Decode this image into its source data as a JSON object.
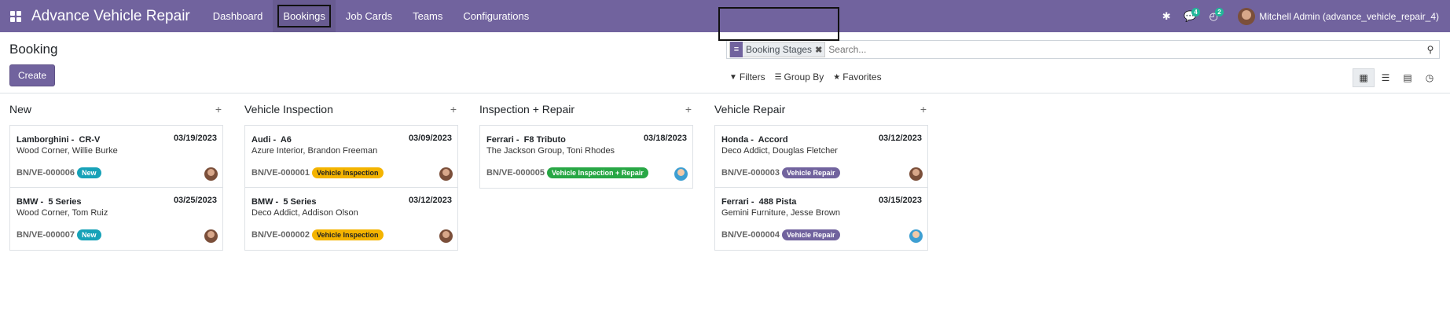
{
  "navbar": {
    "app_title": "Advance Vehicle Repair",
    "menu": [
      "Dashboard",
      "Bookings",
      "Job Cards",
      "Teams",
      "Configurations"
    ],
    "active_menu": "Bookings",
    "messages_count": "4",
    "activities_count": "2",
    "user_name": "Mitchell Admin (advance_vehicle_repair_4)"
  },
  "control": {
    "breadcrumb": "Booking",
    "create_label": "Create",
    "facet_label": "Booking Stages",
    "search_placeholder": "Search...",
    "filters_label": "Filters",
    "groupby_label": "Group By",
    "favorites_label": "Favorites"
  },
  "columns": [
    {
      "title": "New",
      "cards": [
        {
          "vehicle": "Lamborghini -  CR-V",
          "date": "03/19/2023",
          "customer": "Wood Corner, Willie Burke",
          "ref": "BN/VE-000006",
          "tag": "New"
        },
        {
          "vehicle": "BMW -  5 Series",
          "date": "03/25/2023",
          "customer": "Wood Corner, Tom Ruiz",
          "ref": "BN/VE-000007",
          "tag": "New"
        }
      ]
    },
    {
      "title": "Vehicle Inspection",
      "cards": [
        {
          "vehicle": "Audi -  A6",
          "date": "03/09/2023",
          "customer": "Azure Interior, Brandon Freeman",
          "ref": "BN/VE-000001",
          "tag": "Vehicle Inspection"
        },
        {
          "vehicle": "BMW -  5 Series",
          "date": "03/12/2023",
          "customer": "Deco Addict, Addison Olson",
          "ref": "BN/VE-000002",
          "tag": "Vehicle Inspection"
        }
      ]
    },
    {
      "title": "Inspection + Repair",
      "cards": [
        {
          "vehicle": "Ferrari -  F8 Tributo",
          "date": "03/18/2023",
          "customer": "The Jackson Group, Toni Rhodes",
          "ref": "BN/VE-000005",
          "tag": "Vehicle Inspection + Repair"
        }
      ]
    },
    {
      "title": "Vehicle Repair",
      "cards": [
        {
          "vehicle": "Honda -  Accord",
          "date": "03/12/2023",
          "customer": "Deco Addict, Douglas Fletcher",
          "ref": "BN/VE-000003",
          "tag": "Vehicle Repair"
        },
        {
          "vehicle": "Ferrari -  488 Pista",
          "date": "03/15/2023",
          "customer": "Gemini Furniture, Jesse Brown",
          "ref": "BN/VE-000004",
          "tag": "Vehicle Repair"
        }
      ]
    }
  ],
  "colors": {
    "brand": "#71639e",
    "tag_new": "#17a2b8",
    "tag_inspection": "#f4b400",
    "tag_inspection_repair": "#28a745",
    "tag_repair": "#71639e"
  }
}
